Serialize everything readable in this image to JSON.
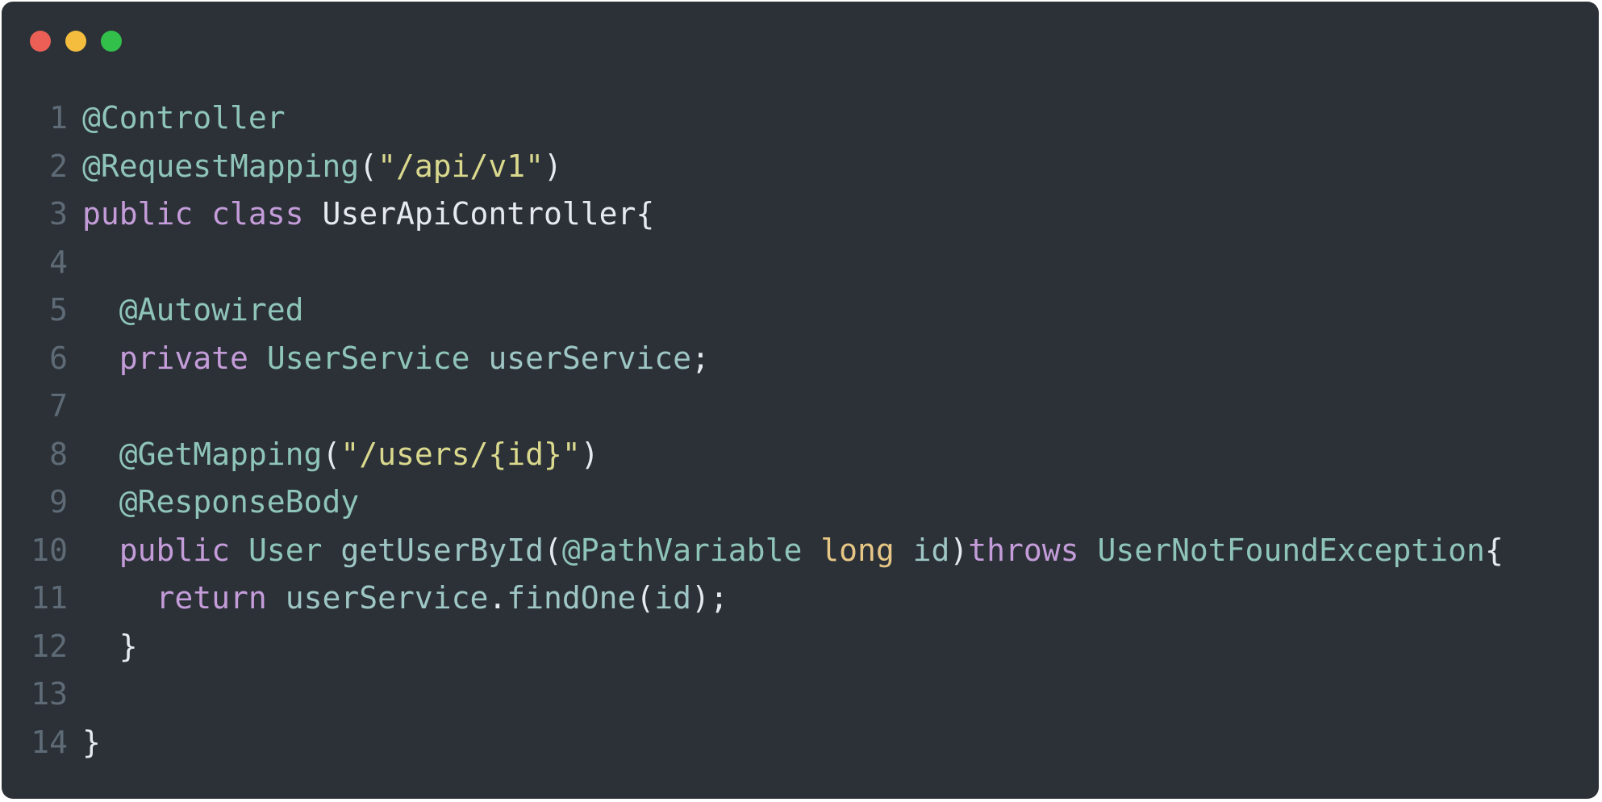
{
  "window": {
    "traffic_lights": [
      {
        "name": "close",
        "color": "#ec5f57"
      },
      {
        "name": "minimize",
        "color": "#f4bd3e"
      },
      {
        "name": "maximize",
        "color": "#32c04b"
      }
    ]
  },
  "code": {
    "language": "java",
    "lines": [
      {
        "number": "1",
        "indent": "",
        "tokens": [
          {
            "t": "@Controller",
            "k": "annotation"
          }
        ]
      },
      {
        "number": "2",
        "indent": "",
        "tokens": [
          {
            "t": "@RequestMapping",
            "k": "annotation"
          },
          {
            "t": "(",
            "k": "punct"
          },
          {
            "t": "\"/api/v1\"",
            "k": "string"
          },
          {
            "t": ")",
            "k": "punct"
          }
        ]
      },
      {
        "number": "3",
        "indent": "",
        "tokens": [
          {
            "t": "public",
            "k": "keyword"
          },
          {
            "t": " ",
            "k": "punct"
          },
          {
            "t": "class",
            "k": "keyword"
          },
          {
            "t": " ",
            "k": "punct"
          },
          {
            "t": "UserApiController",
            "k": "class"
          },
          {
            "t": "{",
            "k": "punct"
          }
        ]
      },
      {
        "number": "4",
        "indent": "",
        "tokens": []
      },
      {
        "number": "5",
        "indent": "  ",
        "tokens": [
          {
            "t": "@Autowired",
            "k": "annotation"
          }
        ]
      },
      {
        "number": "6",
        "indent": "  ",
        "tokens": [
          {
            "t": "private",
            "k": "keyword"
          },
          {
            "t": " ",
            "k": "punct"
          },
          {
            "t": "UserService",
            "k": "type"
          },
          {
            "t": " ",
            "k": "punct"
          },
          {
            "t": "userService",
            "k": "ident"
          },
          {
            "t": ";",
            "k": "punct"
          }
        ]
      },
      {
        "number": "7",
        "indent": "",
        "tokens": []
      },
      {
        "number": "8",
        "indent": "  ",
        "tokens": [
          {
            "t": "@GetMapping",
            "k": "annotation"
          },
          {
            "t": "(",
            "k": "punct"
          },
          {
            "t": "\"/users/{id}\"",
            "k": "string"
          },
          {
            "t": ")",
            "k": "punct"
          }
        ]
      },
      {
        "number": "9",
        "indent": "  ",
        "tokens": [
          {
            "t": "@ResponseBody",
            "k": "annotation"
          }
        ]
      },
      {
        "number": "10",
        "indent": "  ",
        "tokens": [
          {
            "t": "public",
            "k": "keyword"
          },
          {
            "t": " ",
            "k": "punct"
          },
          {
            "t": "User",
            "k": "type"
          },
          {
            "t": " ",
            "k": "punct"
          },
          {
            "t": "getUserById",
            "k": "ident"
          },
          {
            "t": "(",
            "k": "punct"
          },
          {
            "t": "@PathVariable",
            "k": "annotation"
          },
          {
            "t": " ",
            "k": "punct"
          },
          {
            "t": "long",
            "k": "prim"
          },
          {
            "t": " ",
            "k": "punct"
          },
          {
            "t": "id",
            "k": "ident"
          },
          {
            "t": ")",
            "k": "punct"
          },
          {
            "t": "throws",
            "k": "keyword"
          },
          {
            "t": " ",
            "k": "punct"
          },
          {
            "t": "UserNotFoundException",
            "k": "type"
          },
          {
            "t": "{",
            "k": "punct"
          }
        ]
      },
      {
        "number": "11",
        "indent": "    ",
        "tokens": [
          {
            "t": "return",
            "k": "keyword"
          },
          {
            "t": " ",
            "k": "punct"
          },
          {
            "t": "userService",
            "k": "ident"
          },
          {
            "t": ".",
            "k": "punct"
          },
          {
            "t": "findOne",
            "k": "ident"
          },
          {
            "t": "(",
            "k": "punct"
          },
          {
            "t": "id",
            "k": "ident"
          },
          {
            "t": ");",
            "k": "punct"
          }
        ]
      },
      {
        "number": "12",
        "indent": "  ",
        "tokens": [
          {
            "t": "}",
            "k": "punct"
          }
        ]
      },
      {
        "number": "13",
        "indent": "",
        "tokens": []
      },
      {
        "number": "14",
        "indent": "",
        "tokens": [
          {
            "t": "}",
            "k": "punct"
          }
        ]
      }
    ]
  }
}
